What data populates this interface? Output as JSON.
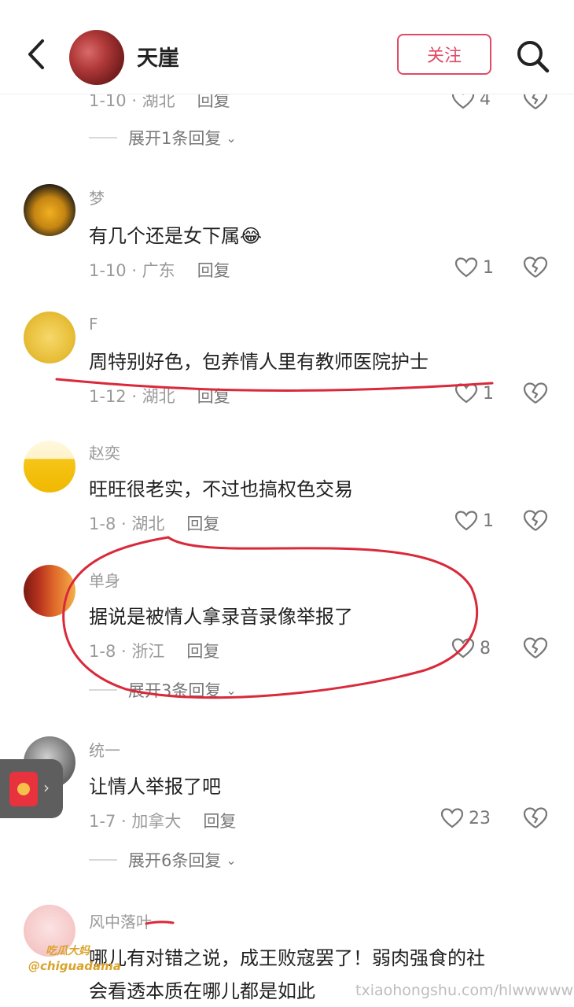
{
  "header": {
    "user_name": "天崖",
    "follow_label": "关注"
  },
  "top_partial": {
    "meta": "1-10 · 湖北",
    "reply_label": "回复",
    "likes": "4",
    "expand_label": "展开1条回复"
  },
  "comments": [
    {
      "user": "梦",
      "text": "有几个还是女下属😂",
      "meta": "1-10 · 广东",
      "reply": "回复",
      "likes": "1"
    },
    {
      "user": "F",
      "text": "周特别好色，包养情人里有教师医院护士",
      "meta": "1-12 · 湖北",
      "reply": "回复",
      "likes": "1"
    },
    {
      "user": "赵奕",
      "text": "旺旺很老实，不过也搞权色交易",
      "meta": "1-8 · 湖北",
      "reply": "回复",
      "likes": "1"
    },
    {
      "user": "单身",
      "text": "据说是被情人拿录音录像举报了",
      "meta": "1-8 · 浙江",
      "reply": "回复",
      "likes": "8",
      "expand": "展开3条回复"
    },
    {
      "user": "统一",
      "text": "让情人举报了吧",
      "meta": "1-7 · 加拿大",
      "reply": "回复",
      "likes": "23",
      "expand": "展开6条回复"
    },
    {
      "user": "风中落叶",
      "text_line1": "哪儿有对错之说，成王败寇罢了！弱肉强食的社",
      "text_line2": "会看透本质在哪儿都是如此"
    }
  ],
  "watermarks": {
    "brand": "吃瓜大妈",
    "handle": "@chiguadama",
    "site": "txiaohongshu.com/hlwwwww"
  },
  "colors": {
    "accent": "#e04a66",
    "annotation": "#d9293a"
  }
}
